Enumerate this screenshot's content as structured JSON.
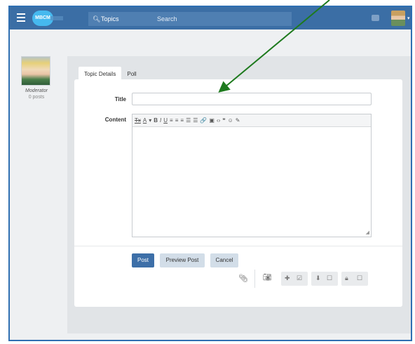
{
  "topbar": {
    "logo_text": "MBCM",
    "topics_label": "Topics",
    "search_placeholder": "Search"
  },
  "author": {
    "role": "Moderator",
    "posts": "0 posts"
  },
  "composer": {
    "tabs": [
      "Topic Details",
      "Poll"
    ],
    "active_tab": "Topic Details",
    "title_label": "Title",
    "title_value": "",
    "content_label": "Content",
    "content_value": "",
    "toolbar_glyphs": [
      "Tx",
      "A",
      "▾",
      "B",
      "I",
      "U",
      "≡",
      "≡",
      "≡",
      "☰",
      "☰",
      "🔗",
      "▣",
      "‹›",
      "❝",
      "☺",
      "✎"
    ],
    "buttons": {
      "post": "Post",
      "preview": "Preview Post",
      "cancel": "Cancel"
    }
  },
  "colors": {
    "topbar": "#3b6ea5",
    "primary_button": "#3d6fa8",
    "secondary_button": "#d2dde8",
    "annotation_arrow": "#1e7a1e",
    "frame_border": "#2f6fb2"
  }
}
